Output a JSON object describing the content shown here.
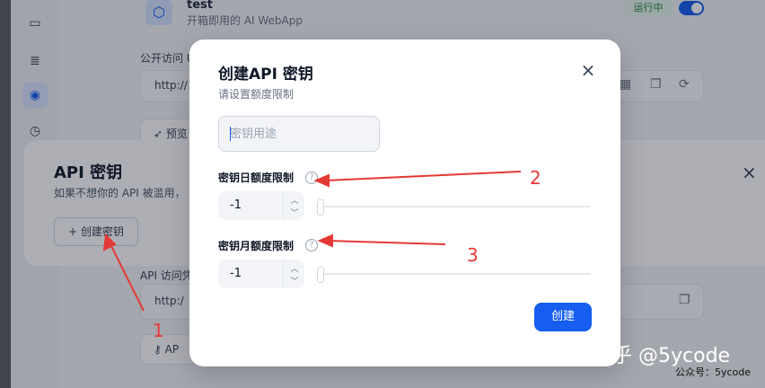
{
  "background": {
    "app_name": "test",
    "app_desc": "开箱即用的 AI WebApp",
    "status": "运行中",
    "public_access_label": "公开访问 U",
    "url_prefix": "http://",
    "preview_label": "预览",
    "api_access_label": "API 访问凭",
    "url_prefix_2": "http:/",
    "api_ref_label": "AP"
  },
  "api_panel": {
    "title": "API 密钥",
    "description": "如果不想你的 API 被滥用，",
    "create_button": "+ 创建密钥",
    "close": "×"
  },
  "modal": {
    "title": "创建API 密钥",
    "subtitle": "请设置额度限制",
    "close": "×",
    "purpose_placeholder": "密钥用途",
    "daily_label": "密钥日额度限制",
    "daily_value": "-1",
    "monthly_label": "密钥月额度限制",
    "monthly_value": "-1",
    "help": "?",
    "create_button": "创建"
  },
  "annotations": {
    "n1": "1",
    "n2": "2",
    "n3": "3",
    "watermark": "知乎 @5ycode",
    "watermark_small": "公众号：5ycode",
    "color": "#e53935"
  },
  "colors": {
    "primary": "#155eef",
    "overlay": "rgba(16,24,40,0.35)"
  }
}
